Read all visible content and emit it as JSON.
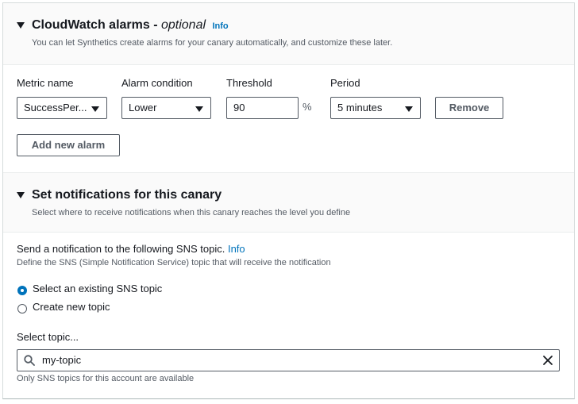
{
  "alarms_section": {
    "title": "CloudWatch alarms - ",
    "title_optional": "optional",
    "info": "Info",
    "description": "You can let Synthetics create alarms for your canary automatically, and customize these later.",
    "columns": {
      "metric": "Metric name",
      "condition": "Alarm condition",
      "threshold": "Threshold",
      "period": "Period"
    },
    "alarm": {
      "metric_value": "SuccessPer...",
      "condition_value": "Lower",
      "threshold_value": "90",
      "threshold_unit": "%",
      "period_value": "5 minutes",
      "remove_label": "Remove"
    },
    "add_label": "Add new alarm"
  },
  "notifications_section": {
    "title": "Set notifications for this canary",
    "description": "Select where to receive notifications when this canary reaches the level you define",
    "sns_prompt": "Send a notification to the following SNS topic.",
    "info": "Info",
    "sns_description": "Define the SNS (Simple Notification Service) topic that will receive the notification",
    "radio_existing": "Select an existing SNS topic",
    "radio_new": "Create new topic",
    "selected_option": "existing",
    "topic_label": "Select topic...",
    "topic_value": "my-topic",
    "topic_hint": "Only SNS topics for this account are available"
  },
  "colors": {
    "accent": "#0073bb",
    "text": "#16191f",
    "muted": "#545b64"
  }
}
